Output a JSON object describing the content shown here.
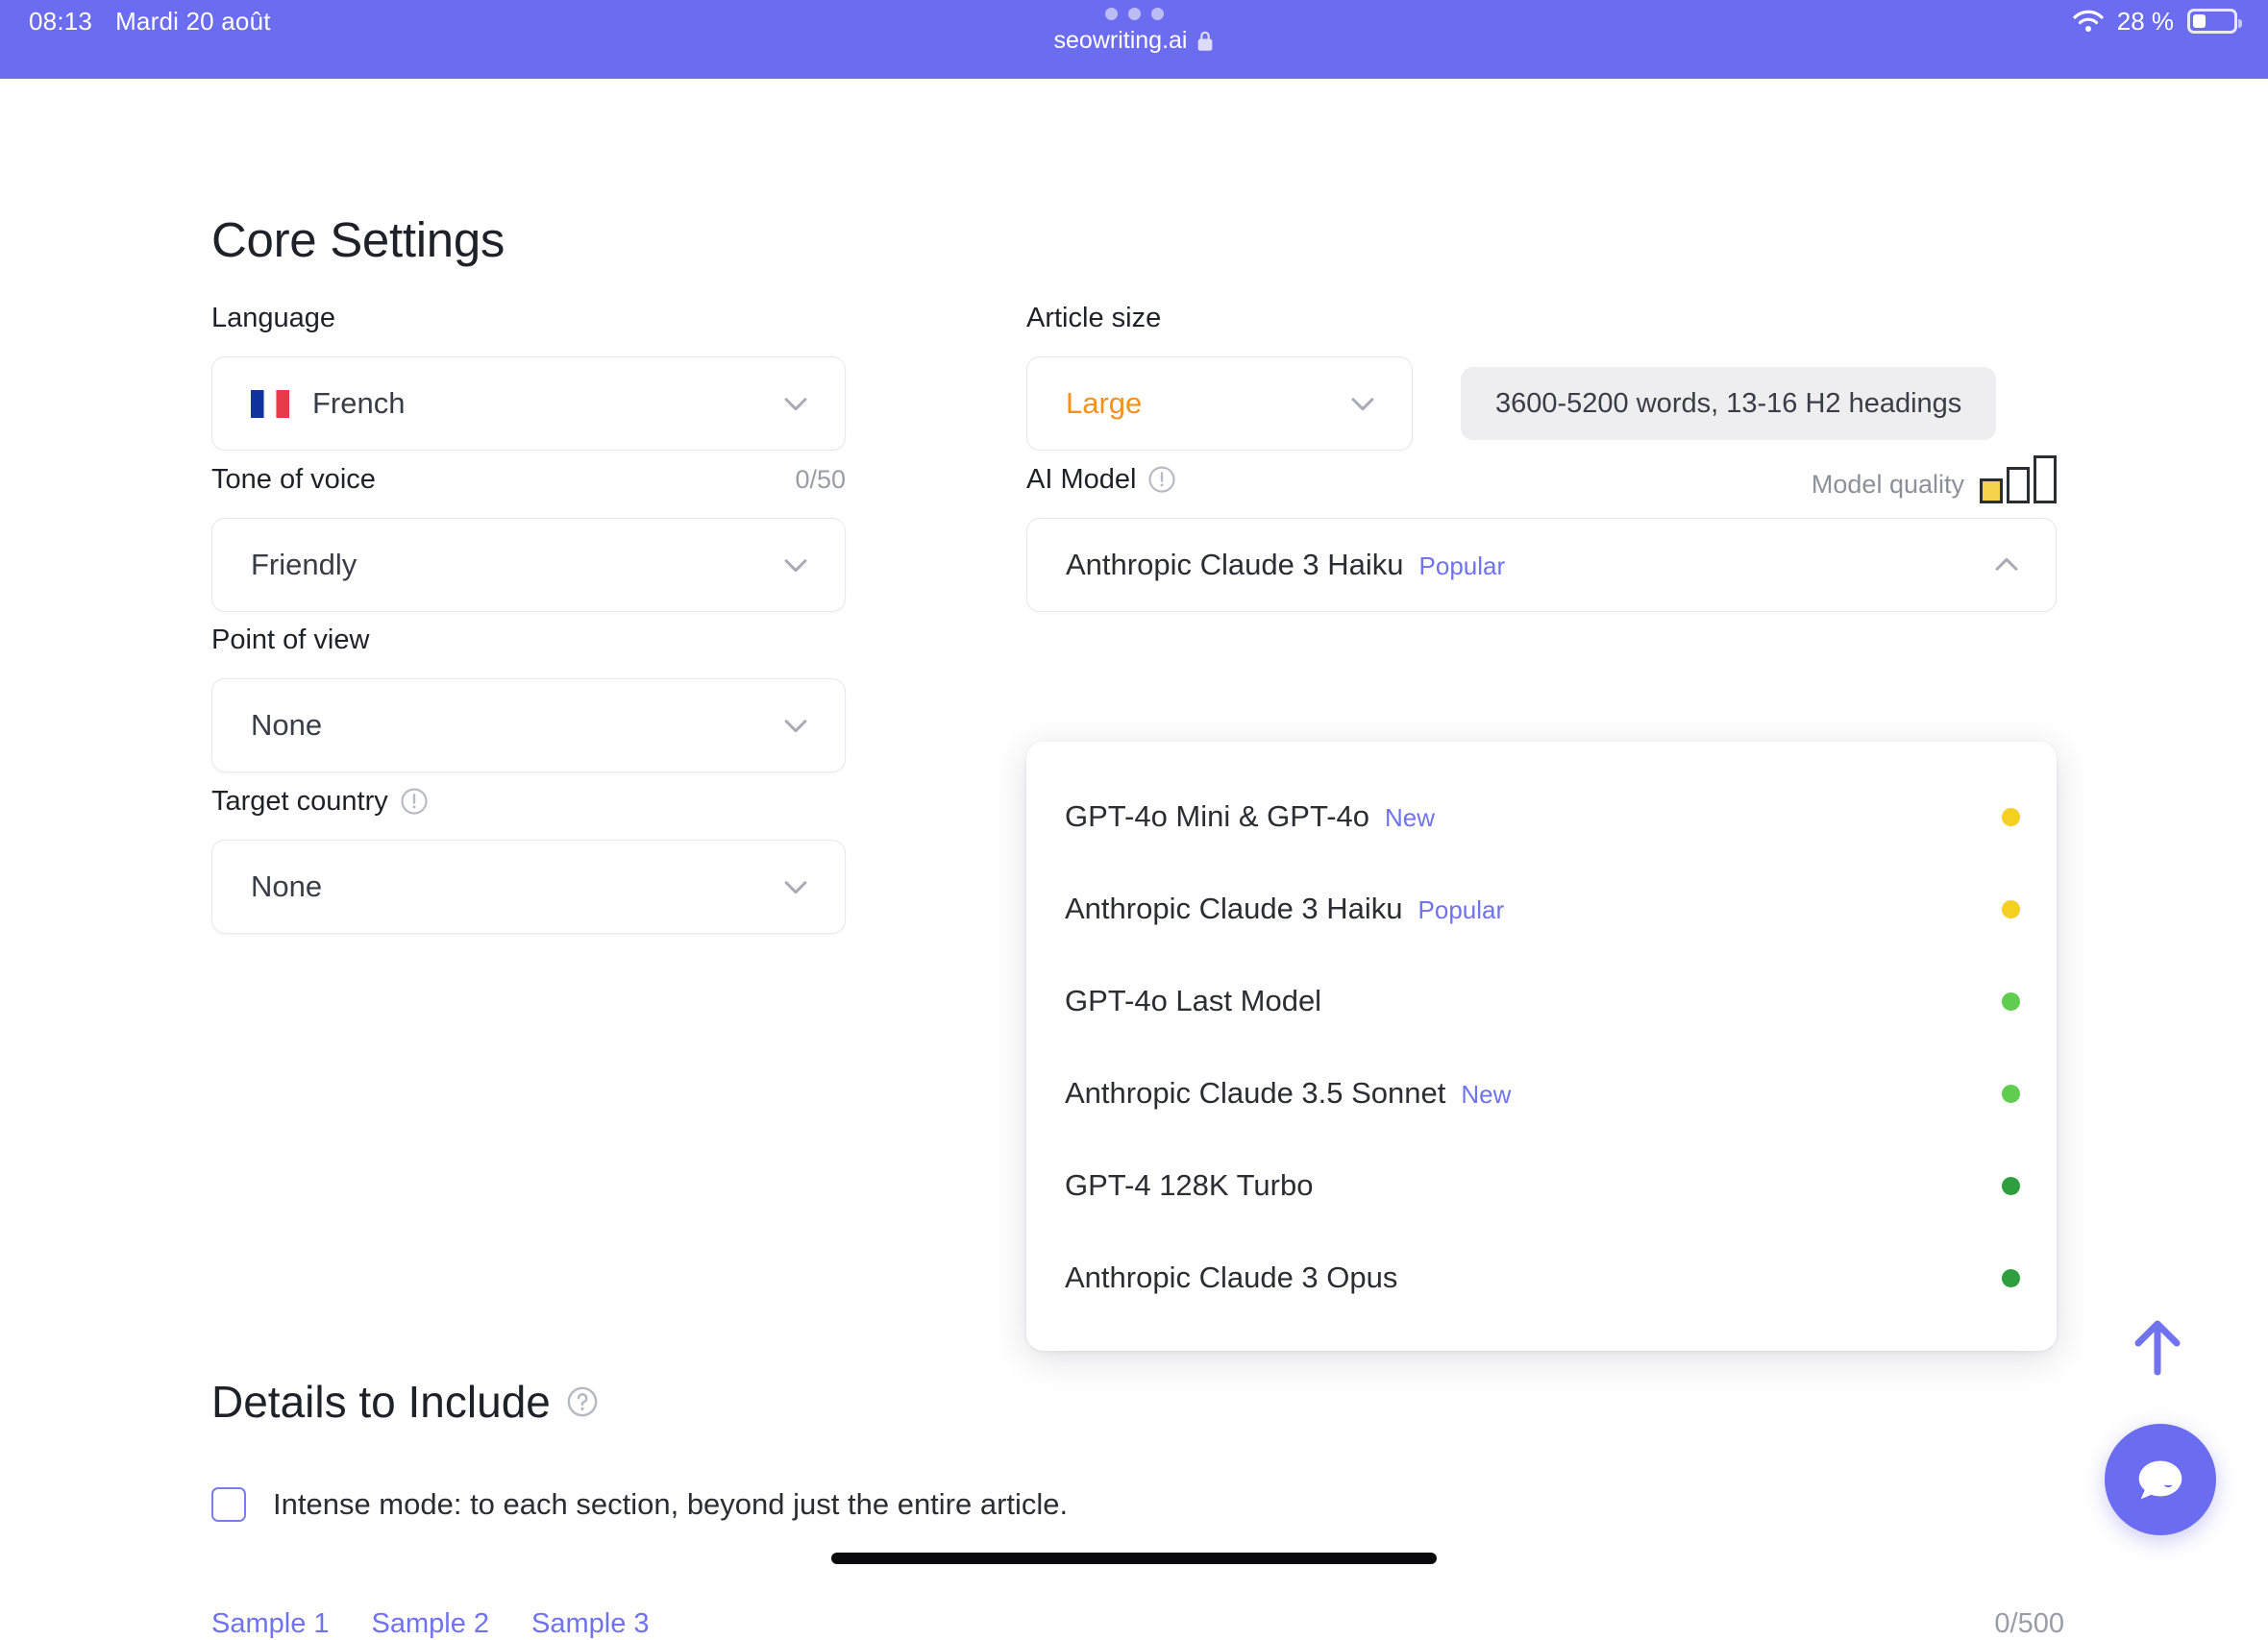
{
  "statusbar": {
    "time": "08:13",
    "date": "Mardi 20 août",
    "battery_percent": "28 %",
    "tab_url": "seowriting.ai",
    "wifi_icon": "wifi-icon",
    "lock_icon": "lock-icon",
    "battery_icon": "battery-icon"
  },
  "page": {
    "title": "Core Settings"
  },
  "left": {
    "language": {
      "label": "Language",
      "value": "French",
      "flag": "flag-france"
    },
    "tone": {
      "label": "Tone of voice",
      "counter": "0/50",
      "value": "Friendly"
    },
    "pov": {
      "label": "Point of view",
      "value": "None"
    },
    "country": {
      "label": "Target country",
      "value": "None",
      "info_icon": "info-icon"
    }
  },
  "right": {
    "article_size": {
      "label": "Article size",
      "value": "Large",
      "hint": "3600-5200 words, 13-16 H2 headings"
    },
    "ai_model": {
      "label": "AI Model",
      "info_icon": "info-icon",
      "quality_label": "Model quality",
      "quality_level": 1,
      "selected": "Anthropic Claude 3 Haiku",
      "selected_badge": "Popular",
      "chevron_icon": "chevron-up-icon",
      "options": [
        {
          "label": "GPT-4o Mini & GPT-4o",
          "badge": "New",
          "dot": "#f5d020"
        },
        {
          "label": "Anthropic Claude 3 Haiku",
          "badge": "Popular",
          "dot": "#f5d020"
        },
        {
          "label": "GPT-4o Last Model",
          "badge": "",
          "dot": "#5fce4e"
        },
        {
          "label": "Anthropic Claude 3.5 Sonnet",
          "badge": "New",
          "dot": "#5fce4e"
        },
        {
          "label": "GPT-4 128K Turbo",
          "badge": "",
          "dot": "#2f9e3f"
        },
        {
          "label": "Anthropic Claude 3 Opus",
          "badge": "",
          "dot": "#2f9e3f"
        }
      ]
    }
  },
  "details": {
    "title": "Details to Include",
    "help_icon": "help-icon",
    "intense_mode": {
      "label": "Intense mode: to each section, beyond just the entire article.",
      "checked": false
    },
    "samples": [
      "Sample 1",
      "Sample 2",
      "Sample 3"
    ],
    "char_count": "0/500"
  },
  "floating": {
    "scroll_top_icon": "arrow-up-icon",
    "chat_icon": "chat-bubble-icon"
  },
  "colors": {
    "brand_purple": "#6b6cf0",
    "link_purple": "#7072ee",
    "accent_orange": "#f0921f",
    "quality_yellow": "#f3d44c"
  }
}
